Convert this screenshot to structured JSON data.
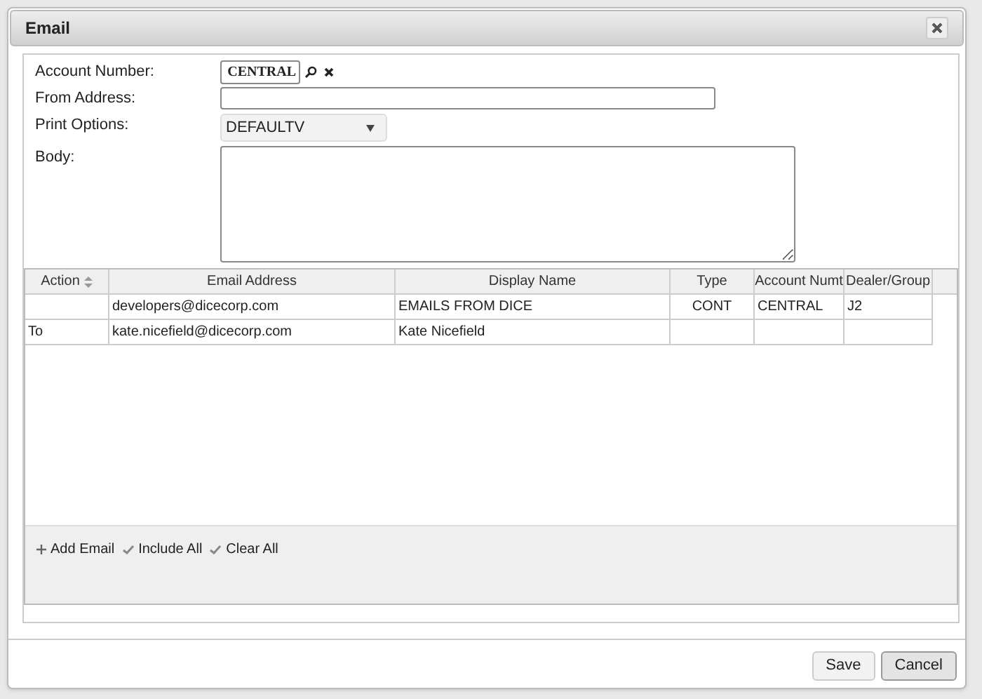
{
  "window": {
    "title": "Email"
  },
  "form": {
    "account_number": {
      "label": "Account Number:",
      "value": "CENTRAL"
    },
    "from_address": {
      "label": "From Address:"
    },
    "print_options": {
      "label": "Print Options:",
      "value": "DEFAULTV"
    },
    "body": {
      "label": "Body:"
    }
  },
  "table": {
    "columns": [
      {
        "label": "Action",
        "sortable": true
      },
      {
        "label": "Email Address",
        "sortable": false
      },
      {
        "label": "Display Name",
        "sortable": false
      },
      {
        "label": "Type",
        "sortable": false
      },
      {
        "label": "Account Numt",
        "sortable": false
      },
      {
        "label": "Dealer/Group",
        "sortable": false
      }
    ],
    "rows": [
      [
        "",
        "developers@dicecorp.com",
        "EMAILS FROM DICE",
        "CONT",
        "CENTRAL",
        "J2"
      ],
      [
        "To",
        "kate.nicefield@dicecorp.com",
        "Kate Nicefield",
        "",
        "",
        ""
      ]
    ]
  },
  "toolbar": [
    {
      "kind": "add",
      "label": "Add Email"
    },
    {
      "kind": "check",
      "label": "Include All"
    },
    {
      "kind": "check",
      "label": "Clear All"
    }
  ],
  "buttons": [
    {
      "label": "Save",
      "primary": false
    },
    {
      "label": "Cancel",
      "primary": true
    }
  ]
}
